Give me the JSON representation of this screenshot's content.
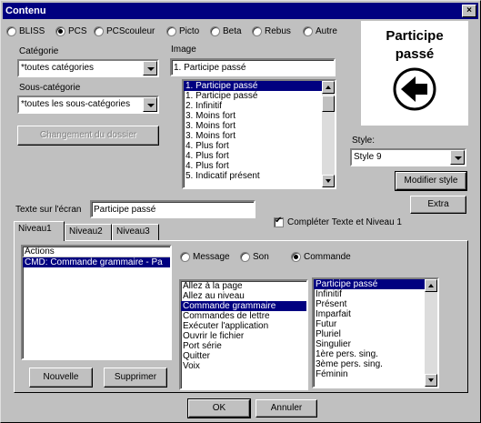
{
  "window": {
    "title": "Contenu",
    "close": "×"
  },
  "symbol_types": [
    {
      "label": "BLISS",
      "selected": false
    },
    {
      "label": "PCS",
      "selected": true
    },
    {
      "label": "PCScouleur",
      "selected": false
    },
    {
      "label": "Picto",
      "selected": false
    },
    {
      "label": "Beta",
      "selected": false
    },
    {
      "label": "Rebus",
      "selected": false
    },
    {
      "label": "Autre",
      "selected": false
    }
  ],
  "categorie": {
    "label": "Catégorie",
    "value": "*toutes catégories"
  },
  "sous_categorie": {
    "label": "Sous-catégorie",
    "value": "*toutes les sous-catégories"
  },
  "changement_button": "Changement du dossier",
  "image": {
    "label": "Image",
    "value": "1. Participe passé",
    "items": [
      "1. Participe passé",
      "1. Participe passé",
      "2. Infinitif",
      "3. Moins fort",
      "3. Moins fort",
      "3. Moins fort",
      "4. Plus fort",
      "4. Plus fort",
      "4. Plus fort",
      "5. Indicatif présent"
    ],
    "selected_index": 0
  },
  "preview": {
    "line1": "Participe",
    "line2": "passé"
  },
  "style": {
    "label": "Style:",
    "value": "Style 9"
  },
  "modifier_style_button": "Modifier style",
  "extra_button": "Extra",
  "texte_ecran": {
    "label": "Texte sur l'écran",
    "value": "Participe passé"
  },
  "completer": {
    "label": "Compléter Texte et Niveau 1",
    "checked": true
  },
  "tabs": [
    {
      "label": "Niveau1",
      "active": true
    },
    {
      "label": "Niveau2",
      "active": false
    },
    {
      "label": "Niveau3",
      "active": false
    }
  ],
  "actions": {
    "header": "Actions",
    "items": [
      "CMD: Commande grammaire - Pa"
    ]
  },
  "action_types": [
    {
      "label": "Message",
      "selected": false
    },
    {
      "label": "Son",
      "selected": false
    },
    {
      "label": "Commande",
      "selected": true
    }
  ],
  "commands": {
    "items": [
      "Allez à la page",
      "Allez au niveau",
      "Commande grammaire",
      "Commandes de lettre",
      "Exécuter l'application",
      "Ouvrir le fichier",
      "Port série",
      "Quitter",
      "Voix"
    ],
    "selected_index": 2
  },
  "grammar": {
    "items": [
      "Participe passé",
      "Infinitif",
      "Présent",
      "Imparfait",
      "Futur",
      "Pluriel",
      "Singulier",
      "1ère pers. sing.",
      "3ème pers. sing.",
      "Féminin"
    ],
    "selected_index": 0
  },
  "nouvelle_button": "Nouvelle",
  "supprimer_button": "Supprimer",
  "ok_button": "OK",
  "annuler_button": "Annuler"
}
